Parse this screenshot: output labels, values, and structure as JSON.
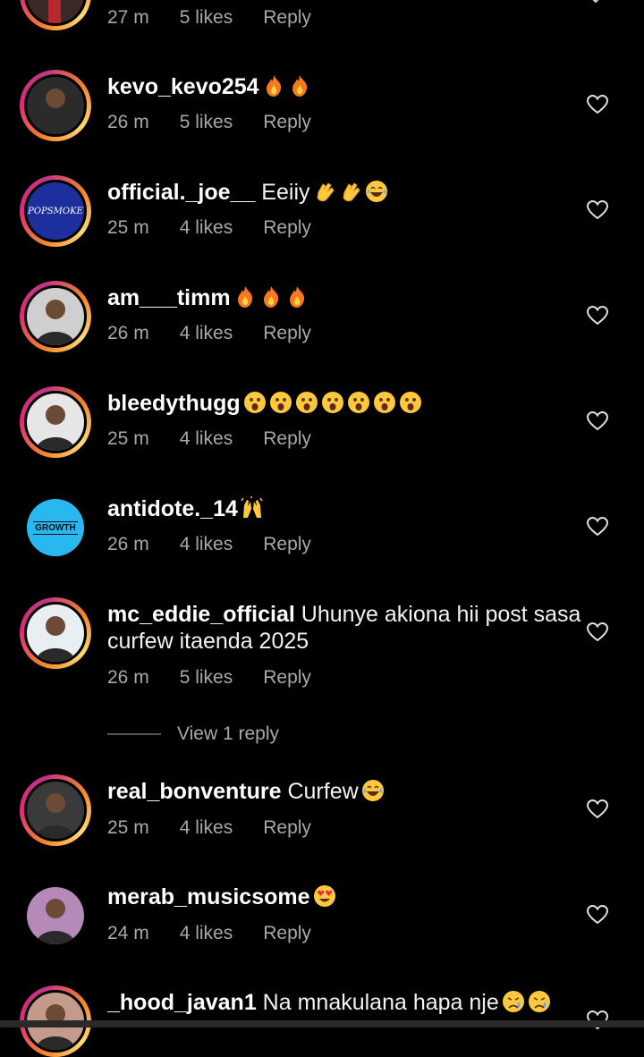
{
  "top_meta": {
    "time": "27 m",
    "likes": "5 likes",
    "reply": "Reply"
  },
  "comments": [
    {
      "user": "kevo_kevo254",
      "text": "",
      "emojis": [
        "fire",
        "fire"
      ],
      "time": "26 m",
      "likes": "5 likes",
      "reply": "Reply"
    },
    {
      "user": "official._joe__",
      "text": " Eeiiy",
      "emojis": [
        "clap",
        "clap",
        "laugh"
      ],
      "time": "25 m",
      "likes": "4 likes",
      "reply": "Reply"
    },
    {
      "user": "am___timm",
      "text": "",
      "emojis": [
        "fire",
        "fire",
        "fire"
      ],
      "time": "26 m",
      "likes": "4 likes",
      "reply": "Reply"
    },
    {
      "user": "bleedythugg",
      "text": "",
      "emojis": [
        "wow",
        "wow",
        "wow",
        "wow",
        "wow",
        "wow",
        "wow"
      ],
      "time": "25 m",
      "likes": "4 likes",
      "reply": "Reply"
    },
    {
      "user": "antidote._14",
      "text": "",
      "emojis": [
        "raise"
      ],
      "time": "26 m",
      "likes": "4 likes",
      "reply": "Reply",
      "avatar_text": "GROWTH"
    },
    {
      "user": "mc_eddie_official",
      "text": " Uhunye akiona hii post sasa curfew itaenda 2025",
      "emojis": [],
      "time": "26 m",
      "likes": "5 likes",
      "reply": "Reply"
    },
    {
      "user": "real_bonventure",
      "text": " Curfew",
      "emojis": [
        "laugh"
      ],
      "time": "25 m",
      "likes": "4 likes",
      "reply": "Reply"
    },
    {
      "user": "merab_musicsome",
      "text": "",
      "emojis": [
        "hearteyes"
      ],
      "time": "24 m",
      "likes": "4 likes",
      "reply": "Reply"
    },
    {
      "user": "_hood_javan1",
      "text": " Na mnakulana hapa nje",
      "emojis": [
        "cry",
        "cry"
      ],
      "time": "",
      "likes": "",
      "reply": ""
    }
  ],
  "view_reply": "View 1 reply",
  "avatar_texts": {
    "popsmoke": "POPSMOKE"
  },
  "colors": {
    "background": "#000000",
    "meta": "#a8a8a8",
    "ring_start": "#f58529",
    "ring_end": "#dd2a7b"
  }
}
